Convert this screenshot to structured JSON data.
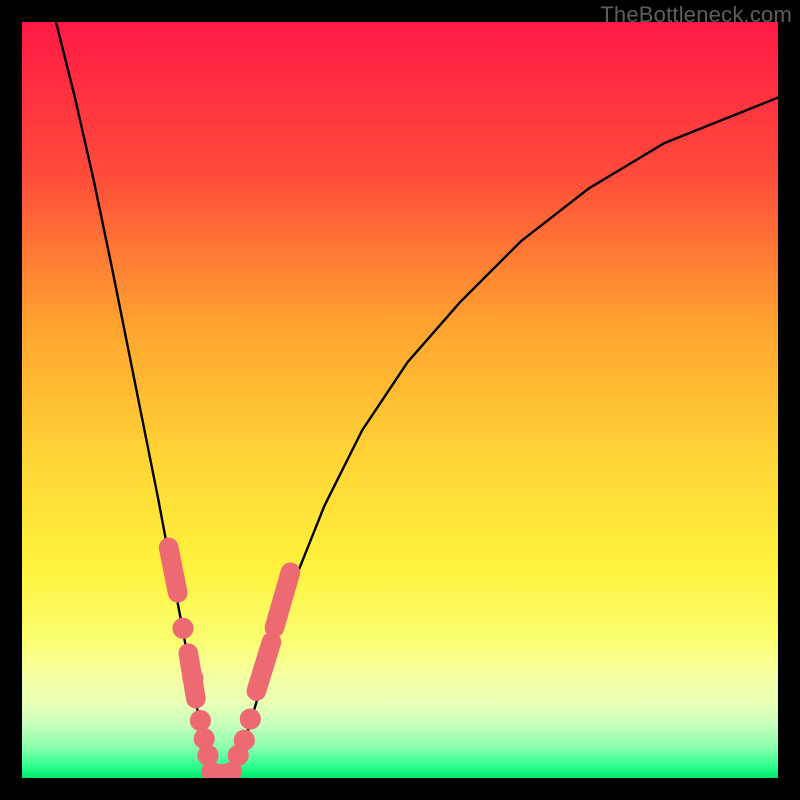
{
  "watermark": {
    "text": "TheBottleneck.com"
  },
  "chart_data": {
    "type": "line",
    "title": "",
    "xlabel": "",
    "ylabel": "",
    "xlim": [
      0,
      100
    ],
    "ylim": [
      0,
      100
    ],
    "grid": false,
    "background": {
      "type": "vertical-gradient",
      "stops": [
        {
          "pos": 0.0,
          "color": "#ff1a46"
        },
        {
          "pos": 0.2,
          "color": "#ff4b3a"
        },
        {
          "pos": 0.4,
          "color": "#ffa32f"
        },
        {
          "pos": 0.58,
          "color": "#ffd536"
        },
        {
          "pos": 0.72,
          "color": "#fff23c"
        },
        {
          "pos": 0.82,
          "color": "#faff72"
        },
        {
          "pos": 0.86,
          "color": "#f6ffa0"
        },
        {
          "pos": 0.9,
          "color": "#e9ffb5"
        },
        {
          "pos": 0.93,
          "color": "#c7ffbb"
        },
        {
          "pos": 0.96,
          "color": "#8affae"
        },
        {
          "pos": 0.985,
          "color": "#2bff8f"
        },
        {
          "pos": 1.0,
          "color": "#00e867"
        }
      ]
    },
    "series": [
      {
        "name": "left-branch",
        "color": "#000000",
        "x": [
          4.5,
          7.0,
          9.5,
          12.0,
          14.0,
          16.0,
          18.0,
          19.5,
          21.0,
          22.3,
          23.2,
          24.0,
          24.6,
          25.0
        ],
        "y": [
          100,
          90,
          79,
          67,
          57,
          47,
          37,
          29,
          21,
          14,
          9,
          5,
          2,
          0.6
        ]
      },
      {
        "name": "right-branch",
        "color": "#000000",
        "x": [
          27.8,
          28.4,
          29.5,
          31.0,
          33.0,
          36.0,
          40.0,
          45.0,
          51.0,
          58.0,
          66.0,
          75.0,
          85.0,
          95.0,
          100.0
        ],
        "y": [
          0.6,
          2,
          5,
          10,
          17,
          26,
          36,
          46,
          55,
          63,
          71,
          78,
          84,
          88,
          90
        ]
      }
    ],
    "valley_floor": {
      "x": [
        25.0,
        27.8
      ],
      "y": 0.6
    },
    "markers": {
      "color": "#ee6a72",
      "left_capsules": [
        {
          "x1": 19.4,
          "y1": 30.5,
          "x2": 20.6,
          "y2": 24.5,
          "w": 2.6
        },
        {
          "x1": 22.0,
          "y1": 16.5,
          "x2": 23.0,
          "y2": 10.5,
          "w": 2.6
        }
      ],
      "left_dots": [
        {
          "x": 21.3,
          "y": 19.8,
          "r": 1.4
        },
        {
          "x": 22.6,
          "y": 13.2,
          "r": 1.4
        },
        {
          "x": 23.6,
          "y": 7.6,
          "r": 1.4
        },
        {
          "x": 24.1,
          "y": 5.2,
          "r": 1.4
        },
        {
          "x": 24.6,
          "y": 3.0,
          "r": 1.4
        }
      ],
      "right_capsules": [
        {
          "x1": 31.0,
          "y1": 11.5,
          "x2": 33.0,
          "y2": 18.0,
          "w": 2.6
        },
        {
          "x1": 33.4,
          "y1": 19.9,
          "x2": 35.5,
          "y2": 27.2,
          "w": 2.6
        }
      ],
      "right_dots": [
        {
          "x": 28.6,
          "y": 3.0,
          "r": 1.4
        },
        {
          "x": 29.4,
          "y": 5.0,
          "r": 1.4
        },
        {
          "x": 30.2,
          "y": 7.8,
          "r": 1.4
        }
      ],
      "floor_dots": [
        {
          "x": 25.0,
          "y": 0.9,
          "r": 1.3
        },
        {
          "x": 25.7,
          "y": 0.6,
          "r": 1.3
        },
        {
          "x": 26.4,
          "y": 0.55,
          "r": 1.3
        },
        {
          "x": 27.1,
          "y": 0.6,
          "r": 1.3
        },
        {
          "x": 27.8,
          "y": 0.9,
          "r": 1.3
        }
      ]
    }
  }
}
